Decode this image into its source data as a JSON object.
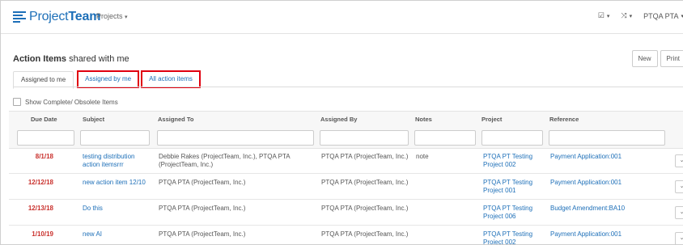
{
  "nav": {
    "logo_light": "Project",
    "logo_bold": "Team",
    "projects_label": "Projects",
    "user_label": "PTQA PTA"
  },
  "page": {
    "title_bold": "Action Items",
    "title_rest": " shared with me"
  },
  "toolbar": {
    "new_label": "New",
    "print_label": "Print"
  },
  "tabs": [
    {
      "label": "Assigned to me",
      "active": true,
      "highlighted": false
    },
    {
      "label": "Assigned by me",
      "active": false,
      "highlighted": true
    },
    {
      "label": "All action items",
      "active": false,
      "highlighted": true
    }
  ],
  "show_complete_label": "Show Complete/ Obsolete Items",
  "columns": [
    "Due Date",
    "Subject",
    "Assigned To",
    "Assigned By",
    "Notes",
    "Project",
    "Reference"
  ],
  "rows": [
    {
      "due": "8/1/18",
      "subject": "testing distribution action itemsrrr",
      "assigned_to": "Debbie Rakes (ProjectTeam, Inc.), PTQA PTA (ProjectTeam, Inc.)",
      "assigned_by": "PTQA PTA (ProjectTeam, Inc.)",
      "notes": "note",
      "project": "PTQA PT Testing Project 002",
      "reference": "Payment Application:001"
    },
    {
      "due": "12/12/18",
      "subject": "new action item 12/10",
      "assigned_to": "PTQA PTA (ProjectTeam, Inc.)",
      "assigned_by": "PTQA PTA (ProjectTeam, Inc.)",
      "notes": "",
      "project": "PTQA PT Testing Project 001",
      "reference": "Payment Application:001"
    },
    {
      "due": "12/13/18",
      "subject": "Do this",
      "assigned_to": "PTQA PTA (ProjectTeam, Inc.)",
      "assigned_by": "PTQA PTA (ProjectTeam, Inc.)",
      "notes": "",
      "project": "PTQA PT Testing Project 006",
      "reference": "Budget Amendment:BA10"
    },
    {
      "due": "1/10/19",
      "subject": "new AI",
      "assigned_to": "PTQA PTA (ProjectTeam, Inc.)",
      "assigned_by": "PTQA PTA (ProjectTeam, Inc.)",
      "notes": "",
      "project": "PTQA PT Testing Project 002",
      "reference": "Payment Application:001"
    }
  ],
  "colors": {
    "brand": "#1d6fb8",
    "due": "#c9302c",
    "highlight": "#e0000f"
  }
}
